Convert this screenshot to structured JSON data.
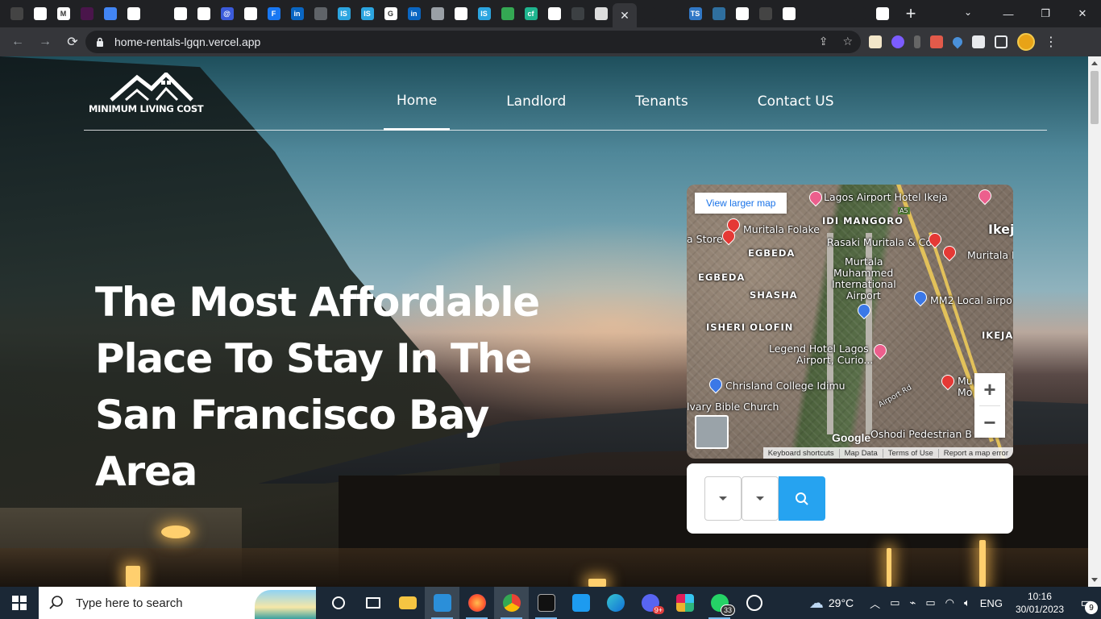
{
  "browser": {
    "url": "home-rentals-lgqn.vercel.app",
    "tabs": [
      {
        "name": "github",
        "color": "#444444",
        "glyph": ""
      },
      {
        "name": "web",
        "color": "#ffffff",
        "glyph": ""
      },
      {
        "name": "gmail",
        "color": "#ffffff",
        "glyph": "M"
      },
      {
        "name": "slack",
        "color": "#4a154b",
        "glyph": ""
      },
      {
        "name": "docs",
        "color": "#4285f4",
        "glyph": ""
      },
      {
        "name": "web",
        "color": "#ffffff",
        "glyph": ""
      },
      {
        "name": "drop",
        "color": "#202124",
        "glyph": ""
      },
      {
        "name": "store",
        "color": "#ffffff",
        "glyph": ""
      },
      {
        "name": "web",
        "color": "#ffffff",
        "glyph": ""
      },
      {
        "name": "at",
        "color": "#3b5bdb",
        "glyph": "@"
      },
      {
        "name": "web",
        "color": "#ffffff",
        "glyph": ""
      },
      {
        "name": "f",
        "color": "#1877f2",
        "glyph": "F"
      },
      {
        "name": "linkedin",
        "color": "#0a66c2",
        "glyph": "in"
      },
      {
        "name": "tv",
        "color": "#5f6368",
        "glyph": ""
      },
      {
        "name": "is",
        "color": "#2ca5e0",
        "glyph": "IS"
      },
      {
        "name": "is",
        "color": "#2ca5e0",
        "glyph": "IS"
      },
      {
        "name": "google",
        "color": "#ffffff",
        "glyph": "G"
      },
      {
        "name": "linkedin",
        "color": "#0a66c2",
        "glyph": "in"
      },
      {
        "name": "web",
        "color": "#9aa0a6",
        "glyph": ""
      },
      {
        "name": "web",
        "color": "#ffffff",
        "glyph": ""
      },
      {
        "name": "is",
        "color": "#2ca5e0",
        "glyph": "IS"
      },
      {
        "name": "drive",
        "color": "#34a853",
        "glyph": ""
      },
      {
        "name": "cf",
        "color": "#1fb58f",
        "glyph": "cf"
      },
      {
        "name": "web",
        "color": "#ffffff",
        "glyph": ""
      },
      {
        "name": "vercel",
        "color": "#3c4043",
        "glyph": ""
      },
      {
        "name": "owl",
        "color": "#dddddd",
        "glyph": ""
      }
    ],
    "tabs_after": [
      {
        "name": "vercel",
        "color": "#202124",
        "glyph": ""
      },
      {
        "name": "bot",
        "color": "#202124",
        "glyph": ""
      },
      {
        "name": "ts",
        "color": "#3178c6",
        "glyph": "TS"
      },
      {
        "name": "img",
        "color": "#2f6f9f",
        "glyph": ""
      },
      {
        "name": "web",
        "color": "#ffffff",
        "glyph": ""
      },
      {
        "name": "github",
        "color": "#444444",
        "glyph": ""
      },
      {
        "name": "web",
        "color": "#ffffff",
        "glyph": ""
      },
      {
        "name": "vercel",
        "color": "#202124",
        "glyph": ""
      },
      {
        "name": "drop",
        "color": "#202124",
        "glyph": ""
      },
      {
        "name": "drop",
        "color": "#202124",
        "glyph": ""
      },
      {
        "name": "doc",
        "color": "#ffffff",
        "glyph": ""
      }
    ],
    "new_tab": "+",
    "close_tab": "✕"
  },
  "site": {
    "logo_text": "MINIMUM LIVING COST",
    "nav": [
      {
        "label": "Home",
        "active": true
      },
      {
        "label": "Landlord",
        "active": false
      },
      {
        "label": "Tenants",
        "active": false
      },
      {
        "label": "Contact US",
        "active": false
      }
    ],
    "hero_title": "The Most Affordable Place To Stay In The San Francisco Bay Area"
  },
  "map": {
    "view_larger": "View larger map",
    "labels": [
      {
        "text": "Lagos Airport Hotel Ikeja"
      },
      {
        "text": "IDI MANGORO"
      },
      {
        "text": "Ikej"
      },
      {
        "text": "Muritala Folake"
      },
      {
        "text": "a Store"
      },
      {
        "text": "EGBEDA"
      },
      {
        "text": "Rasaki Muritala & Co"
      },
      {
        "text": "Muritala Ho"
      },
      {
        "text": "EGBEDA"
      },
      {
        "text": "Murtala"
      },
      {
        "text": "Muhammed"
      },
      {
        "text": "International"
      },
      {
        "text": "Airport"
      },
      {
        "text": "SHASHA"
      },
      {
        "text": "MM2 Local airpo"
      },
      {
        "text": "ISHERI OLOFIN"
      },
      {
        "text": "IKEJA G"
      },
      {
        "text": "Legend Hotel Lagos"
      },
      {
        "text": "Airport, Curio..."
      },
      {
        "text": "Chrisland College Idimu"
      },
      {
        "text": "Mu"
      },
      {
        "text": "Mo"
      },
      {
        "text": "ed"
      },
      {
        "text": "lvary Bible Church"
      },
      {
        "text": "Oshodi Pedestrian B"
      },
      {
        "text": "Airport Rd"
      },
      {
        "text": "A5"
      }
    ],
    "google": "Google",
    "footer": [
      "Keyboard shortcuts",
      "Map Data",
      "Terms of Use",
      "Report a map error"
    ],
    "zoom_in": "+",
    "zoom_out": "−"
  },
  "taskbar": {
    "search_placeholder": "Type here to search",
    "weather": "29°C",
    "lang": "ENG",
    "time": "10:16",
    "date": "30/01/2023",
    "notifications": "9",
    "whatsapp_badge": "33",
    "discord_badge": "9+"
  }
}
